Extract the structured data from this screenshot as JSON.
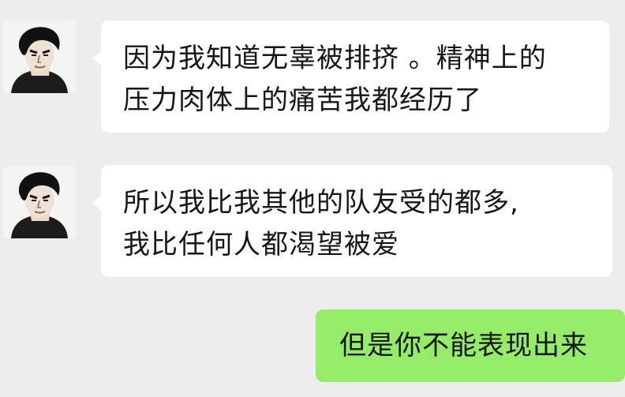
{
  "messages": [
    {
      "direction": "incoming",
      "avatar_icon": "man-avatar-icon",
      "lines": [
        "因为我知道无辜被排挤 。精神上的",
        "压力肉体上的痛苦我都经历了"
      ]
    },
    {
      "direction": "incoming",
      "avatar_icon": "man-avatar-icon",
      "lines": [
        "所以我比我其他的队友受的都多,",
        "我比任何人都渴望被爱"
      ]
    },
    {
      "direction": "outgoing",
      "lines": [
        "但是你不能表现出来"
      ]
    }
  ],
  "colors": {
    "background": "#ededed",
    "incoming_bubble": "#ffffff",
    "outgoing_bubble": "#95ec69",
    "text": "#161616"
  }
}
